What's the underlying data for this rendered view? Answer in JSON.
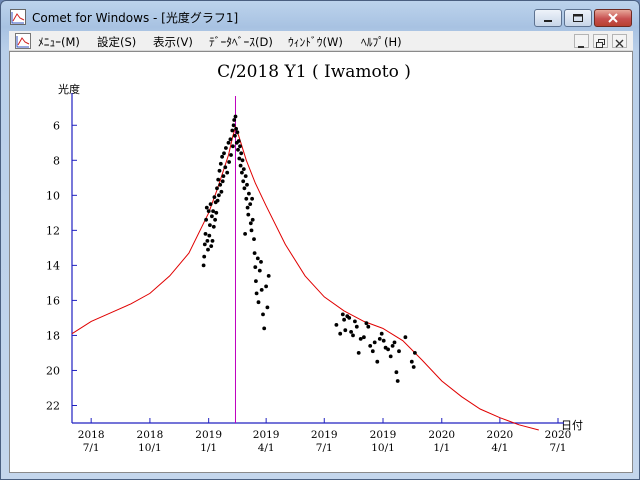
{
  "window": {
    "title": "Comet for Windows - [光度グラフ1]"
  },
  "menu": [
    "ﾒﾆｭｰ(M)",
    "設定(S)",
    "表示(V)",
    "ﾃﾞｰﾀﾍﾞｰｽ(D)",
    "ｳｨﾝﾄﾞｳ(W)",
    "ﾍﾙﾌﾟ(H)"
  ],
  "colors": {
    "curve": "#e00000",
    "marker": "#c000c0",
    "axis": "#2020c0",
    "points": "#000000"
  },
  "chart_data": {
    "type": "scatter",
    "title": "C/2018 Y1 ( Iwamoto )",
    "ylabel": "光度",
    "xlabel": "日付",
    "y_inverted": true,
    "ylim": [
      23,
      4.5
    ],
    "xlim": [
      "2018-06-01",
      "2020-07-01"
    ],
    "y_ticks": [
      6,
      8,
      10,
      12,
      14,
      16,
      18,
      20,
      22
    ],
    "x_ticks": [
      {
        "date": "2018-07-01",
        "year": "2018",
        "md": "7/1"
      },
      {
        "date": "2018-10-01",
        "year": "2018",
        "md": "10/1"
      },
      {
        "date": "2019-01-01",
        "year": "2019",
        "md": "1/1"
      },
      {
        "date": "2019-04-01",
        "year": "2019",
        "md": "4/1"
      },
      {
        "date": "2019-07-01",
        "year": "2019",
        "md": "7/1"
      },
      {
        "date": "2019-10-01",
        "year": "2019",
        "md": "10/1"
      },
      {
        "date": "2020-01-01",
        "year": "2020",
        "md": "1/1"
      },
      {
        "date": "2020-04-01",
        "year": "2020",
        "md": "4/1"
      },
      {
        "date": "2020-07-01",
        "year": "2020",
        "md": "7/1"
      }
    ],
    "marker_date": "2019-02-12",
    "series": [
      {
        "type": "line",
        "points": [
          [
            "2018-06-01",
            17.9
          ],
          [
            "2018-07-01",
            17.2
          ],
          [
            "2018-08-01",
            16.7
          ],
          [
            "2018-09-01",
            16.2
          ],
          [
            "2018-10-01",
            15.6
          ],
          [
            "2018-11-01",
            14.6
          ],
          [
            "2018-12-01",
            13.3
          ],
          [
            "2019-01-01",
            11.0
          ],
          [
            "2019-01-15",
            9.6
          ],
          [
            "2019-02-01",
            7.7
          ],
          [
            "2019-02-08",
            6.6
          ],
          [
            "2019-02-12",
            6.1
          ],
          [
            "2019-02-17",
            6.6
          ],
          [
            "2019-03-01",
            8.0
          ],
          [
            "2019-03-15",
            9.3
          ],
          [
            "2019-04-01",
            10.6
          ],
          [
            "2019-05-01",
            12.8
          ],
          [
            "2019-06-01",
            14.6
          ],
          [
            "2019-07-01",
            15.8
          ],
          [
            "2019-08-01",
            16.6
          ],
          [
            "2019-09-01",
            17.2
          ],
          [
            "2019-10-01",
            17.6
          ],
          [
            "2019-11-01",
            18.3
          ],
          [
            "2019-12-01",
            19.4
          ],
          [
            "2020-01-01",
            20.6
          ],
          [
            "2020-02-01",
            21.5
          ],
          [
            "2020-03-01",
            22.2
          ],
          [
            "2020-04-01",
            22.7
          ],
          [
            "2020-05-01",
            23.1
          ],
          [
            "2020-06-01",
            23.4
          ]
        ]
      },
      {
        "type": "scatter",
        "points": [
          [
            "2018-12-24",
            14.0
          ],
          [
            "2018-12-25",
            13.5
          ],
          [
            "2018-12-26",
            12.8
          ],
          [
            "2018-12-27",
            12.2
          ],
          [
            "2018-12-28",
            11.4
          ],
          [
            "2018-12-29",
            10.7
          ],
          [
            "2018-12-30",
            12.6
          ],
          [
            "2018-12-31",
            13.1
          ],
          [
            "2019-01-01",
            10.9
          ],
          [
            "2019-01-02",
            12.3
          ],
          [
            "2019-01-03",
            11.7
          ],
          [
            "2019-01-04",
            10.5
          ],
          [
            "2019-01-05",
            12.9
          ],
          [
            "2019-01-06",
            11.2
          ],
          [
            "2019-01-07",
            12.6
          ],
          [
            "2019-01-08",
            10.9
          ],
          [
            "2019-01-09",
            11.8
          ],
          [
            "2019-01-10",
            10.1
          ],
          [
            "2019-01-11",
            11.4
          ],
          [
            "2019-01-12",
            10.4
          ],
          [
            "2019-01-13",
            11.0
          ],
          [
            "2019-01-14",
            9.6
          ],
          [
            "2019-01-15",
            10.3
          ],
          [
            "2019-01-16",
            9.1
          ],
          [
            "2019-01-17",
            10.0
          ],
          [
            "2019-01-18",
            8.6
          ],
          [
            "2019-01-19",
            9.4
          ],
          [
            "2019-01-20",
            8.2
          ],
          [
            "2019-01-21",
            9.8
          ],
          [
            "2019-01-22",
            7.8
          ],
          [
            "2019-01-23",
            9.2
          ],
          [
            "2019-01-24",
            8.9
          ],
          [
            "2019-01-25",
            7.6
          ],
          [
            "2019-01-27",
            8.4
          ],
          [
            "2019-01-28",
            7.3
          ],
          [
            "2019-01-30",
            8.7
          ],
          [
            "2019-02-01",
            7.0
          ],
          [
            "2019-02-02",
            8.1
          ],
          [
            "2019-02-04",
            6.8
          ],
          [
            "2019-02-05",
            7.7
          ],
          [
            "2019-02-07",
            6.3
          ],
          [
            "2019-02-08",
            7.2
          ],
          [
            "2019-02-09",
            6.0
          ],
          [
            "2019-02-10",
            5.7
          ],
          [
            "2019-02-11",
            6.6
          ],
          [
            "2019-02-12",
            5.5
          ],
          [
            "2019-02-13",
            6.2
          ],
          [
            "2019-02-14",
            7.0
          ],
          [
            "2019-02-15",
            6.4
          ],
          [
            "2019-02-16",
            7.4
          ],
          [
            "2019-02-17",
            6.9
          ],
          [
            "2019-02-18",
            7.9
          ],
          [
            "2019-02-19",
            7.2
          ],
          [
            "2019-02-20",
            8.3
          ],
          [
            "2019-02-21",
            7.6
          ],
          [
            "2019-02-22",
            8.7
          ],
          [
            "2019-02-23",
            8.0
          ],
          [
            "2019-02-24",
            9.2
          ],
          [
            "2019-02-25",
            8.5
          ],
          [
            "2019-02-26",
            9.6
          ],
          [
            "2019-02-27",
            12.2
          ],
          [
            "2019-02-28",
            8.9
          ],
          [
            "2019-03-01",
            10.2
          ],
          [
            "2019-03-02",
            9.4
          ],
          [
            "2019-03-03",
            10.7
          ],
          [
            "2019-03-04",
            11.1
          ],
          [
            "2019-03-05",
            9.9
          ],
          [
            "2019-03-07",
            10.5
          ],
          [
            "2019-03-08",
            11.6
          ],
          [
            "2019-03-09",
            12.0
          ],
          [
            "2019-03-10",
            10.2
          ],
          [
            "2019-03-11",
            11.4
          ],
          [
            "2019-03-13",
            12.5
          ],
          [
            "2019-03-14",
            13.3
          ],
          [
            "2019-03-15",
            14.1
          ],
          [
            "2019-03-16",
            14.9
          ],
          [
            "2019-03-17",
            15.6
          ],
          [
            "2019-03-19",
            13.6
          ],
          [
            "2019-03-20",
            16.1
          ],
          [
            "2019-03-22",
            14.3
          ],
          [
            "2019-03-24",
            13.8
          ],
          [
            "2019-03-25",
            15.4
          ],
          [
            "2019-03-27",
            16.8
          ],
          [
            "2019-03-29",
            17.6
          ],
          [
            "2019-04-01",
            15.2
          ],
          [
            "2019-04-03",
            16.4
          ],
          [
            "2019-04-05",
            14.6
          ],
          [
            "2019-07-20",
            17.4
          ],
          [
            "2019-07-26",
            17.9
          ],
          [
            "2019-07-30",
            16.8
          ],
          [
            "2019-08-01",
            17.1
          ],
          [
            "2019-08-03",
            17.7
          ],
          [
            "2019-08-06",
            16.9
          ],
          [
            "2019-08-09",
            17.0
          ],
          [
            "2019-08-12",
            17.8
          ],
          [
            "2019-08-15",
            18.0
          ],
          [
            "2019-08-18",
            17.2
          ],
          [
            "2019-08-21",
            17.5
          ],
          [
            "2019-08-24",
            19.0
          ],
          [
            "2019-08-27",
            18.2
          ],
          [
            "2019-09-01",
            18.1
          ],
          [
            "2019-09-05",
            17.3
          ],
          [
            "2019-09-08",
            17.5
          ],
          [
            "2019-09-11",
            18.6
          ],
          [
            "2019-09-15",
            18.9
          ],
          [
            "2019-09-18",
            18.4
          ],
          [
            "2019-09-22",
            19.5
          ],
          [
            "2019-09-26",
            18.2
          ],
          [
            "2019-09-29",
            17.9
          ],
          [
            "2019-10-02",
            18.3
          ],
          [
            "2019-10-05",
            18.7
          ],
          [
            "2019-10-09",
            18.8
          ],
          [
            "2019-10-13",
            19.2
          ],
          [
            "2019-10-16",
            18.6
          ],
          [
            "2019-10-19",
            18.4
          ],
          [
            "2019-10-22",
            20.1
          ],
          [
            "2019-10-24",
            20.6
          ],
          [
            "2019-10-26",
            18.9
          ],
          [
            "2019-11-05",
            18.1
          ],
          [
            "2019-11-15",
            19.5
          ],
          [
            "2019-11-18",
            19.8
          ],
          [
            "2019-11-20",
            19.0
          ]
        ]
      }
    ]
  }
}
